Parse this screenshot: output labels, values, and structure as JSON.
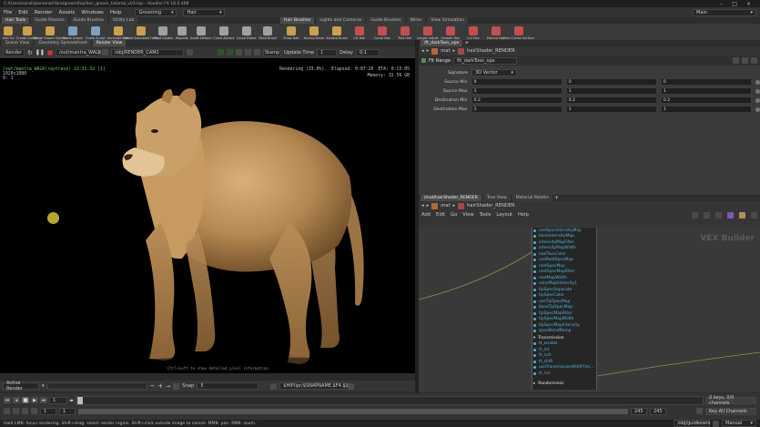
{
  "window": {
    "title": "C:/Users/sarah/personal/Yaro/groom/hip/lion_groom_tutorial_v03.hip - Houdini FX 18.0.408",
    "controls": [
      "–",
      "□",
      "×"
    ]
  },
  "menubar": {
    "items": [
      "File",
      "Edit",
      "Render",
      "Assets",
      "Windows",
      "Help"
    ],
    "desktop": "Grooming",
    "context": "Hair",
    "desktop_name": "Main"
  },
  "shelf": {
    "tabs": [
      "Hair Tools",
      "Guide Process",
      "Guide Brushes",
      "Utility Lab"
    ],
    "tools": [
      {
        "label": "Add Fur",
        "color": "#c9a04c"
      },
      {
        "label": "Create Guides",
        "color": "#c9a04c"
      },
      {
        "label": "Merge Groom Objects",
        "color": "#c9a04c"
      },
      {
        "label": "Guide Groom",
        "color": "#7fa0c0"
      },
      {
        "label": "Guide Sculpt",
        "color": "#7fa0c0"
      },
      {
        "label": "Generate Hair",
        "color": "#c9a04c"
      },
      {
        "label": "Create Animated Hairs",
        "color": "#c9a04c"
      },
      {
        "label": "Plant Guides",
        "color": "#a0a0a0"
      },
      {
        "label": "Reguide",
        "color": "#a0a0a0"
      },
      {
        "label": "Guide Deform",
        "color": "#a0a0a0"
      },
      {
        "label": "Curve Advect",
        "color": "#a0a0a0"
      },
      {
        "label": "Curve Frame",
        "color": "#a0a0a0"
      },
      {
        "label": "Bend Brush",
        "color": "#a0a0a0"
      }
    ],
    "right_tabs": [
      "Hair Brushes",
      "Lights and Cameras",
      "Guide Brushes",
      "Wires",
      "View Simulation"
    ],
    "right_tools": [
      {
        "label": "Show Hair",
        "color": "#c9a04c"
      },
      {
        "label": "Access Brush",
        "color": "#c9a04c"
      },
      {
        "label": "Surface Brush",
        "color": "#c9a04c"
      },
      {
        "label": "Lift Hair",
        "color": "#c05050"
      },
      {
        "label": "Comb Hair",
        "color": "#c05050"
      },
      {
        "label": "Part Hair",
        "color": "#c05050"
      },
      {
        "label": "Length Adjust",
        "color": "#c05050"
      },
      {
        "label": "Smooth Hair",
        "color": "#c05050"
      },
      {
        "label": "Cut Hair",
        "color": "#c05050"
      },
      {
        "label": "Extend Hair",
        "color": "#c05050"
      },
      {
        "label": "Hair Curves Surface",
        "color": "#c05050"
      }
    ]
  },
  "viewer": {
    "tabs": [
      "Scene View",
      "Geometry Spreadsheet",
      "Render View"
    ],
    "toolbar": {
      "render_label": "Render",
      "camera_path": "/out/mantra_WALK",
      "render_path": "/obj/RENDER_CAM1",
      "stamp_label": "Stamp",
      "update_label": "Update Time",
      "update_value": "1",
      "delay_label": "Delay",
      "delay_value": "0.1"
    },
    "overlay": {
      "render_info": "/out/mantra_WALK(raytrace) 13:31:32 [1]",
      "resolution": "1920x1080",
      "cursor_line": "9: 1",
      "status": "Rendering (33.0%).",
      "elapsed": "Elapsed: 0:07:26",
      "eta": "ETA: 0:15:05",
      "memory_label": "Memory:",
      "memory_value": "32.56 GB",
      "hint": "Ctrl+Left to show detailed pixel information."
    },
    "bottom": {
      "active_render": "Active Render",
      "snap_label": "Snap",
      "snap_value": "5",
      "ship_path": "$HIP/ipr/$SNAPNAME.$F4.$1"
    }
  },
  "parms": {
    "tabs": [
      "/ft_darkToes_ope"
    ],
    "path": "mat",
    "node": "hairShader_RENDER",
    "node_type": "Fit Range",
    "node_name": "fit_darkToes_ope",
    "signature_label": "Signature",
    "signature_value": "3D Vector",
    "rows": [
      {
        "label": "Source Min",
        "v": [
          "0",
          "0",
          "0"
        ]
      },
      {
        "label": "Source Max",
        "v": [
          "1",
          "1",
          "1"
        ]
      },
      {
        "label": "Destination Min",
        "v": [
          "0.2",
          "0.2",
          "0.2"
        ]
      },
      {
        "label": "Destination Max",
        "v": [
          "1",
          "1",
          "1"
        ]
      }
    ]
  },
  "network": {
    "tabs": [
      "/mat/hairShader_RENDER",
      "Tree View",
      "Material Palette"
    ],
    "path": "mat",
    "node": "hairShader_RENDER",
    "menu": [
      "Add",
      "Edit",
      "Go",
      "View",
      "Tools",
      "Layout",
      "Help"
    ],
    "watermark": "VEX Builder",
    "params_top": [
      "useSpecIntensityMap",
      "baseIntensityMap",
      "intensityMapFilter",
      "intensityMapWidth",
      "rootToesColor",
      "useRootSpecMap",
      "rootSpecMap",
      "rootSpecMapFilter",
      "rootMapWidth",
      "colorMapIntensity1",
      "tipSpecSeparate",
      "tipSpecColor",
      "useTipSpecMap",
      "baseTipSpecMap",
      "tipSpecMapFilter",
      "tipSpecMapWidth",
      "tipSpecMapIntensity",
      "specBlendRamp"
    ],
    "section1": "Transmission",
    "params_bottom": [
      "tt_enable",
      "tt_int",
      "tt_coh",
      "tt_shift",
      "useTransmissionWithPrim...",
      "tt_col"
    ],
    "section2": "Randomness"
  },
  "timeline": {
    "frame": "1",
    "start": "1",
    "current": "1",
    "end1": "245",
    "end2": "245",
    "keys_info": "0 keys, 0/0 channels",
    "key_all": "Key All Channels",
    "camera": "/obj/guideswrs",
    "mode": "Manual"
  },
  "status": {
    "text": "Hold LMB: focus rendering. Shift+drag: select render region. Shift+click outside image to cancel. MMB: pan. RMB: zoom."
  }
}
